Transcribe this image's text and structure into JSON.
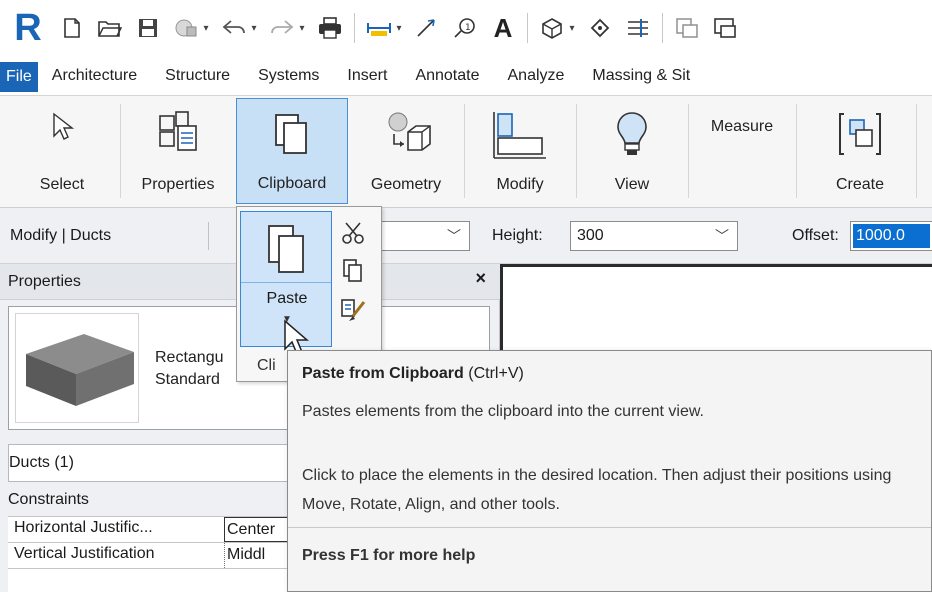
{
  "app": {
    "logo_letter": "R",
    "accent": "#1b65b6"
  },
  "tabs": [
    "File",
    "Architecture",
    "Structure",
    "Systems",
    "Insert",
    "Annotate",
    "Analyze",
    "Massing & Sit"
  ],
  "ribbon": {
    "select": "Select",
    "properties": "Properties",
    "clipboard": "Clipboard",
    "geometry": "Geometry",
    "modify": "Modify",
    "view": "View",
    "measure": "Measure",
    "create": "Create"
  },
  "options_bar": {
    "context": "Modify | Ducts",
    "height_label": "Height:",
    "height_value": "300",
    "offset_label": "Offset:",
    "offset_value": "1000.0"
  },
  "properties": {
    "title": "Properties",
    "close": "×",
    "type_line1": "Rectangu",
    "type_line2": "Standard",
    "instance": "Ducts (1)",
    "group": "Constraints",
    "rows": [
      {
        "name": "Horizontal Justific...",
        "value": "Center"
      },
      {
        "name": "Vertical Justification",
        "value": "Middl"
      }
    ]
  },
  "dropdown": {
    "paste_label": "Paste",
    "footer": "Cli"
  },
  "tooltip": {
    "title": "Paste from Clipboard",
    "shortcut": "(Ctrl+V)",
    "description": "Pastes elements from the clipboard into the current view.",
    "detail": "Click to place the elements in the desired location. Then adjust their positions using Move, Rotate, Align, and other tools.",
    "help": "Press F1 for more help"
  }
}
